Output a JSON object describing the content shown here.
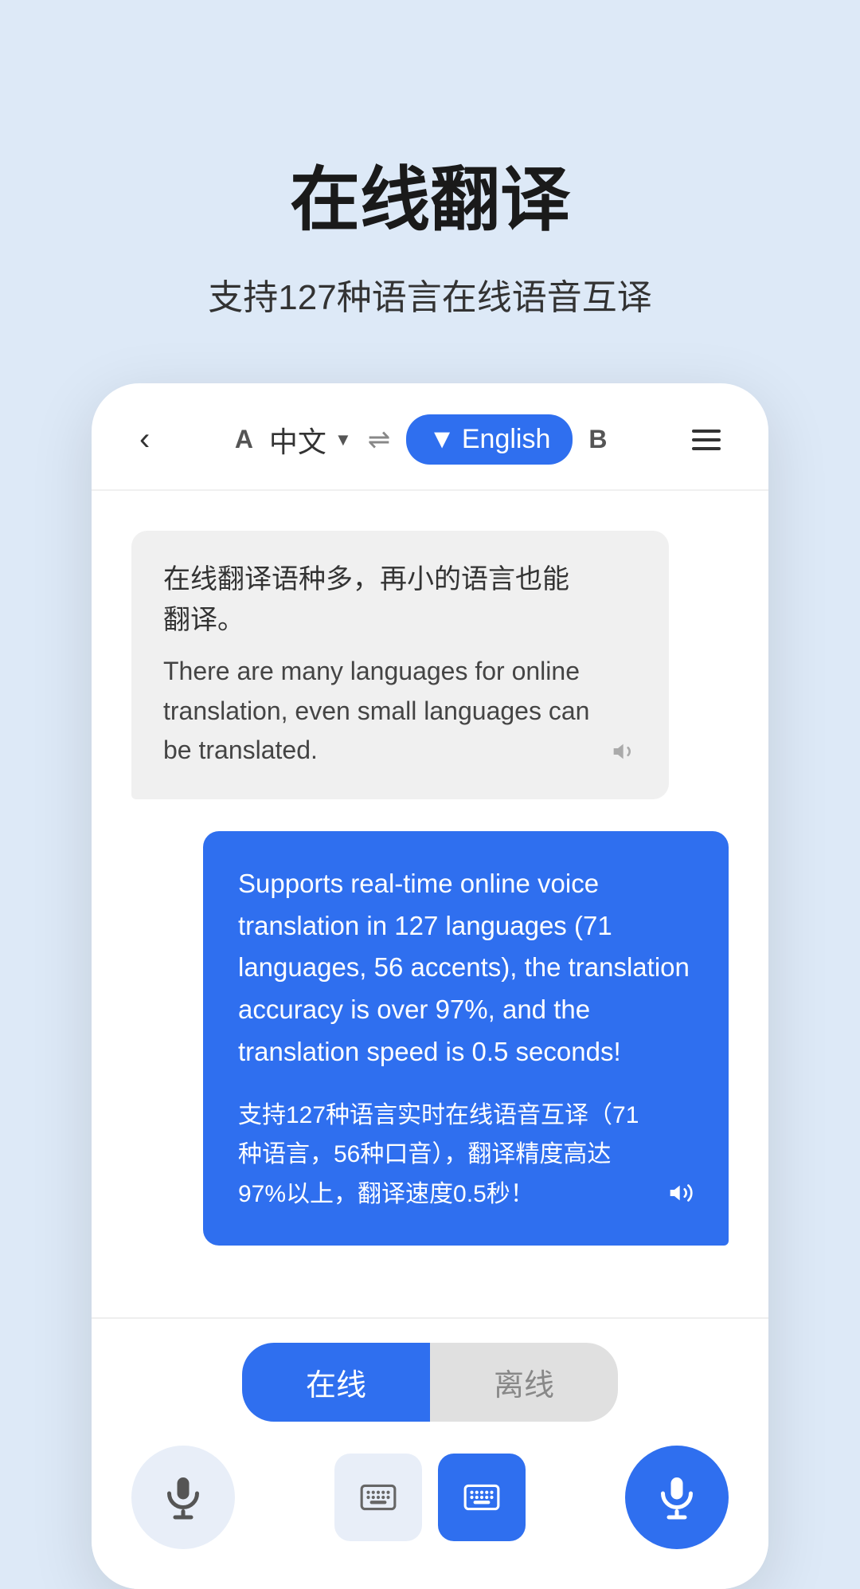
{
  "header": {
    "title": "在线翻译",
    "subtitle": "支持127种语言在线语音互译"
  },
  "topbar": {
    "back_label": "‹",
    "lang_a_label": "A",
    "lang_source": "中文",
    "dropdown_arrow": "▼",
    "swap_icon": "⇌",
    "lang_target": "English",
    "lang_b_label": "B",
    "menu_icon": "≡"
  },
  "chat": {
    "bubble_left": {
      "original": "在线翻译语种多，再小的语言也能翻译。",
      "translated": "There are many languages for online translation, even small languages can be translated.",
      "speaker_icon": "🔈"
    },
    "bubble_right": {
      "english_text": "Supports real-time online voice translation in 127 languages (71 languages, 56 accents), the translation accuracy is over 97%, and the translation speed is 0.5 seconds!",
      "chinese_text": "支持127种语言实时在线语音互译（71种语言，56种口音），翻译精度高达97%以上，翻译速度0.5秒！",
      "speaker_icon": "🔊"
    }
  },
  "bottom": {
    "mode_online": "在线",
    "mode_offline": "离线",
    "mic_left_aria": "microphone left",
    "keyboard_inactive_aria": "keyboard inactive",
    "keyboard_active_aria": "keyboard active",
    "mic_right_aria": "microphone right"
  }
}
